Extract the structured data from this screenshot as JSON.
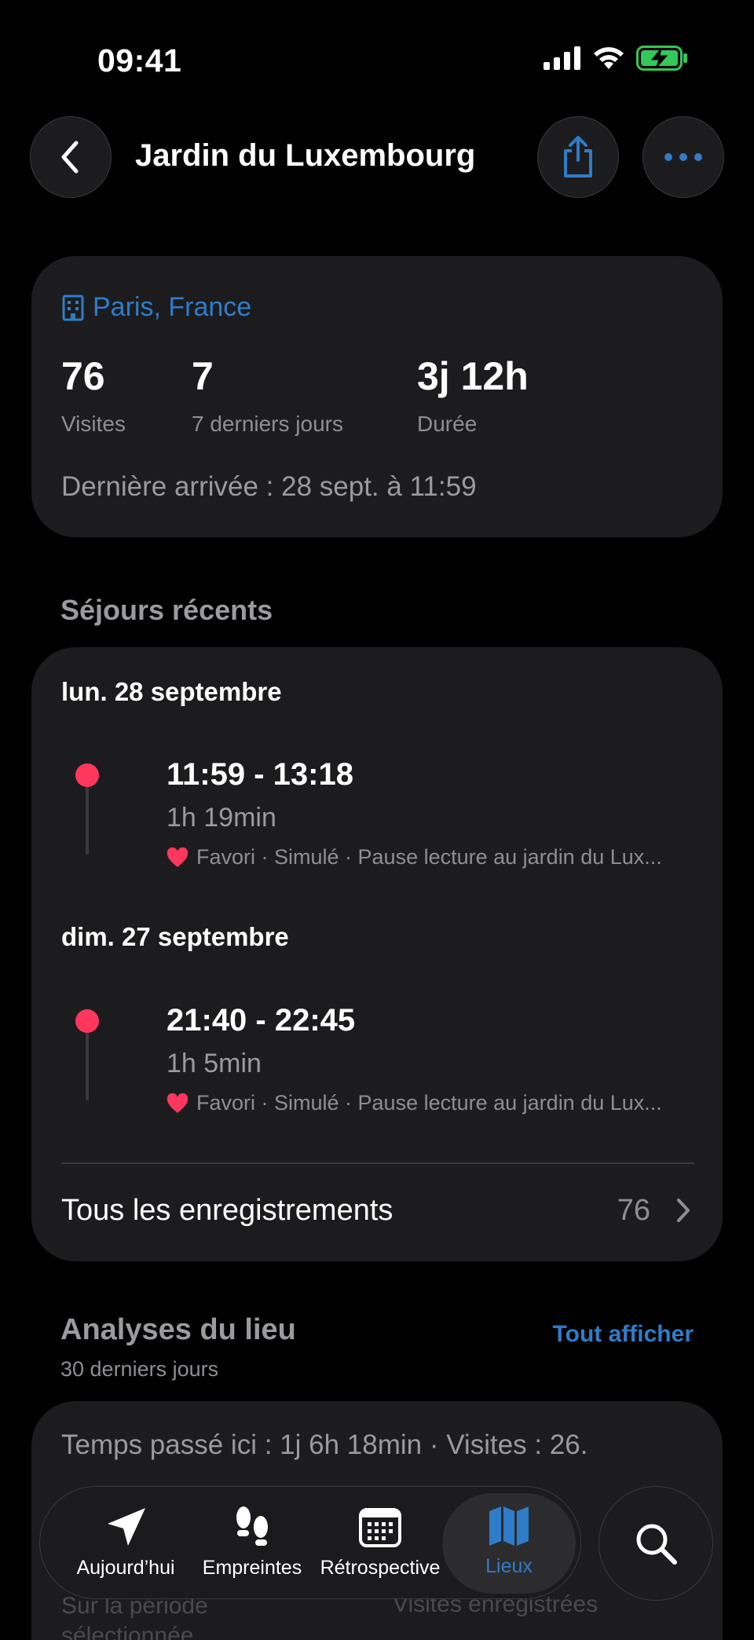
{
  "status_bar": {
    "time": "09:41"
  },
  "header": {
    "title": "Jardin du Luxembourg"
  },
  "summary": {
    "location": "Paris, France",
    "stats": [
      {
        "value": "76",
        "label": "Visites"
      },
      {
        "value": "7",
        "label": "7 derniers jours"
      },
      {
        "value": "3j 12h",
        "label": "Durée"
      }
    ],
    "last_arrival": "Dernière arrivée : 28 sept. à 11:59"
  },
  "recent": {
    "title": "Séjours récents",
    "days": [
      {
        "label": "lun. 28 septembre",
        "range": "11:59 - 13:18",
        "duration": "1h 19min",
        "meta": "Favori · Simulé · Pause lecture au jardin du Lux..."
      },
      {
        "label": "dim. 27 septembre",
        "range": "21:40 - 22:45",
        "duration": "1h 5min",
        "meta": "Favori · Simulé · Pause lecture au jardin du Lux..."
      }
    ],
    "all_label": "Tous les enregistrements",
    "all_count": "76"
  },
  "analyses": {
    "title": "Analyses du lieu",
    "subtitle": "30 derniers jours",
    "see_all": "Tout afficher",
    "summary": "Temps passé ici : 1j 6h 18min · Visites : 26.",
    "left_caption": "Sur la période sélectionnée",
    "right_caption": "Visites enregistrées"
  },
  "tabbar": {
    "tabs": [
      {
        "label": "Aujourd’hui",
        "icon": "location-arrow-icon"
      },
      {
        "label": "Empreintes",
        "icon": "footprints-icon"
      },
      {
        "label": "Rétrospective",
        "icon": "calendar-icon"
      },
      {
        "label": "Lieux",
        "icon": "map-icon"
      }
    ],
    "search_icon": "search-icon"
  },
  "colors": {
    "accent": "#2f7cc9",
    "stay_dot": "#ff375f",
    "heart": "#ff375f",
    "card": "#1c1c1e",
    "battery": "#34c759"
  }
}
